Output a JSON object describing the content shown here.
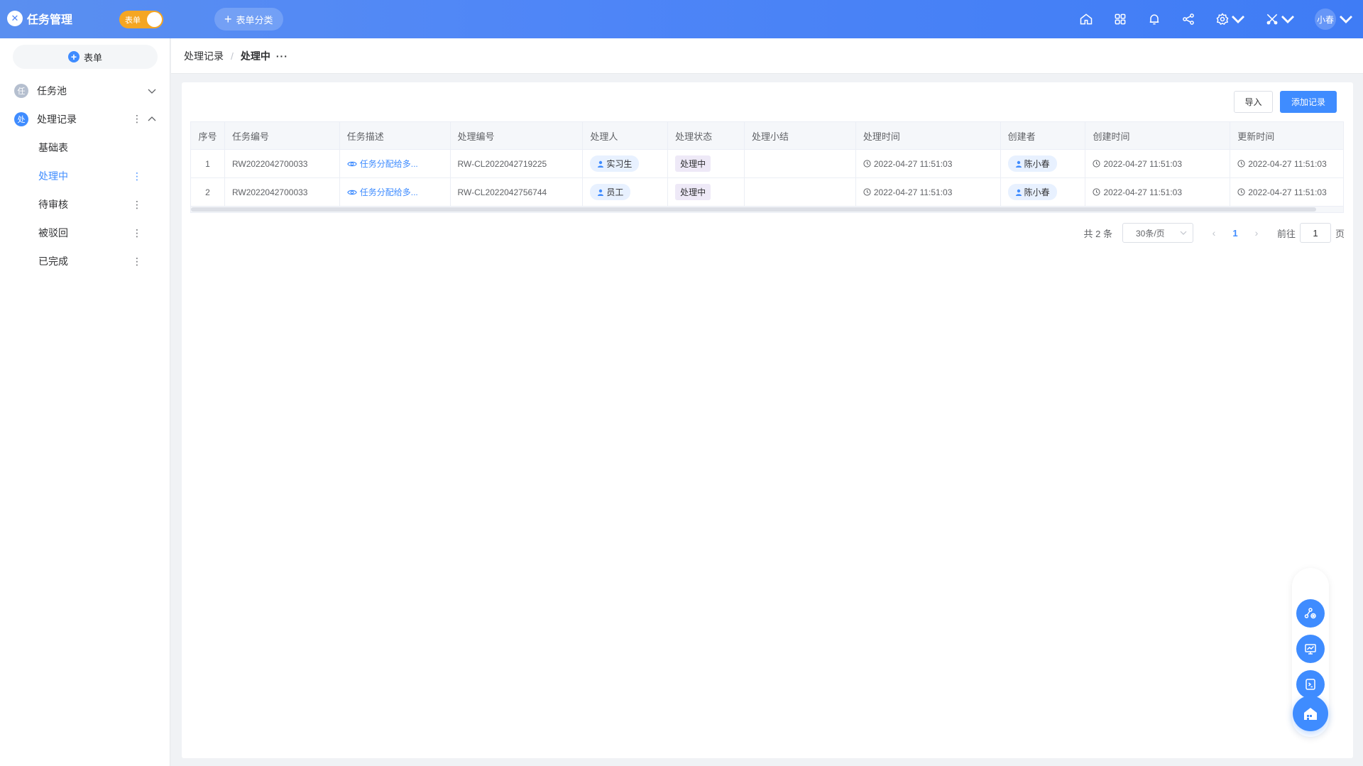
{
  "app": {
    "logo_char": "✕",
    "title": "任务管理"
  },
  "toggle": {
    "label": "表单"
  },
  "category_button": {
    "label": "表单分类"
  },
  "topbar": {
    "user": "小春"
  },
  "sidebar": {
    "form_button": "表单",
    "groups": [
      {
        "badge": "任",
        "label": "任务池"
      },
      {
        "badge": "处",
        "label": "处理记录"
      }
    ],
    "subitems": [
      {
        "label": "基础表"
      },
      {
        "label": "处理中"
      },
      {
        "label": "待审核"
      },
      {
        "label": "被驳回"
      },
      {
        "label": "已完成"
      }
    ]
  },
  "breadcrumb": {
    "parent": "处理记录",
    "separator": "/",
    "current": "处理中",
    "more": "···"
  },
  "toolbar": {
    "import_label": "导入",
    "add_label": "添加记录"
  },
  "table": {
    "headers": [
      "序号",
      "任务编号",
      "任务描述",
      "处理编号",
      "处理人",
      "处理状态",
      "处理小结",
      "处理时间",
      "创建者",
      "创建时间",
      "更新时间"
    ],
    "rows": [
      {
        "index": "1",
        "task_no": "RW2022042700033",
        "desc": "任务分配给多...",
        "proc_no": "RW-CL2022042719225",
        "handler": "实习生",
        "status": "处理中",
        "summary": "",
        "proc_time": "2022-04-27 11:51:03",
        "creator": "陈小春",
        "created": "2022-04-27 11:51:03",
        "updated": "2022-04-27 11:51:03"
      },
      {
        "index": "2",
        "task_no": "RW2022042700033",
        "desc": "任务分配给多...",
        "proc_no": "RW-CL2022042756744",
        "handler": "员工",
        "status": "处理中",
        "summary": "",
        "proc_time": "2022-04-27 11:51:03",
        "creator": "陈小春",
        "created": "2022-04-27 11:51:03",
        "updated": "2022-04-27 11:51:03"
      }
    ]
  },
  "pagination": {
    "total": "共 2 条",
    "page_size": "30条/页",
    "prev": "‹",
    "current": "1",
    "next": "›",
    "goto_label": "前往",
    "goto_value": "1",
    "goto_unit": "页"
  },
  "colors": {
    "accent": "#3f8cff",
    "topbar": "#4f86f7",
    "toggle": "#f5a623"
  }
}
